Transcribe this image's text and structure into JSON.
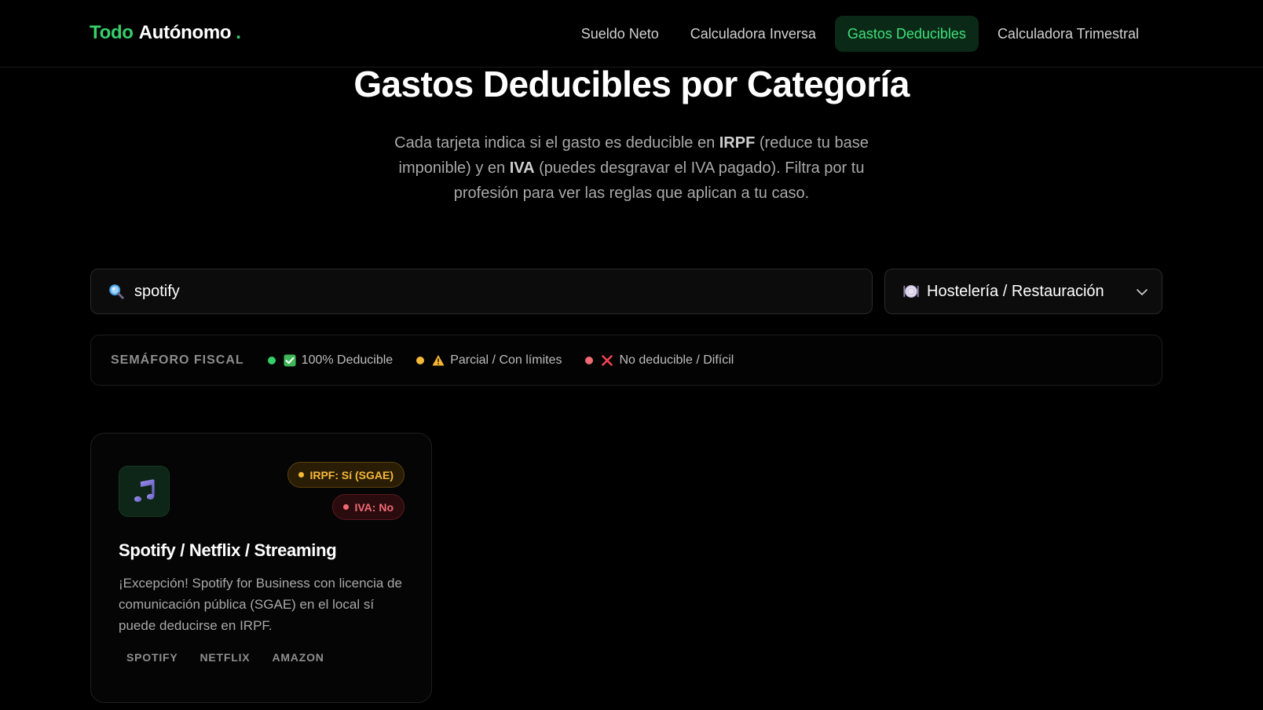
{
  "header": {
    "logo": {
      "part1": "Todo",
      "part2": "Autónomo",
      "dot": "."
    },
    "nav": [
      {
        "label": "Sueldo Neto",
        "active": false
      },
      {
        "label": "Calculadora Inversa",
        "active": false
      },
      {
        "label": "Gastos Deducibles",
        "active": true
      },
      {
        "label": "Calculadora Trimestral",
        "active": false
      }
    ]
  },
  "main": {
    "title": "Gastos Deducibles por Categoría",
    "intro": {
      "p1": "Cada tarjeta indica si el gasto es deducible en ",
      "b1": "IRPF",
      "p2": " (reduce tu base imponible) y en ",
      "b2": "IVA",
      "p3": " (puedes desgravar el IVA pagado). Filtra por tu profesión para ver las reglas que aplican a tu caso."
    }
  },
  "filters": {
    "search": {
      "value": "spotify",
      "icon": "magnifier-icon"
    },
    "profession": {
      "selected": "Hostelería / Restauración",
      "icon": "plate-icon"
    }
  },
  "legend": {
    "title": "SEMÁFORO FISCAL",
    "items": [
      {
        "label": "100% Deducible",
        "dot_color": "#34d06a",
        "icon": "check-box-icon"
      },
      {
        "label": "Parcial / Con límites",
        "dot_color": "#f5b93a",
        "icon": "warning-icon"
      },
      {
        "label": "No deducible / Difícil",
        "dot_color": "#f06b74",
        "icon": "cross-icon"
      }
    ]
  },
  "cards": [
    {
      "icon": "music-note-icon",
      "title": "Spotify / Netflix / Streaming",
      "irpf_badge": "IRPF: Sí (SGAE)",
      "iva_badge": "IVA: No",
      "description": "¡Excepción! Spotify for Business con licencia de comunicación pública (SGAE) en el local sí puede deducirse en IRPF.",
      "tags": [
        "SPOTIFY",
        "NETFLIX",
        "AMAZON"
      ]
    }
  ],
  "colors": {
    "accent_green": "#34d06a",
    "background": "#000000",
    "warning": "#f5b93a",
    "danger": "#f06b74"
  }
}
